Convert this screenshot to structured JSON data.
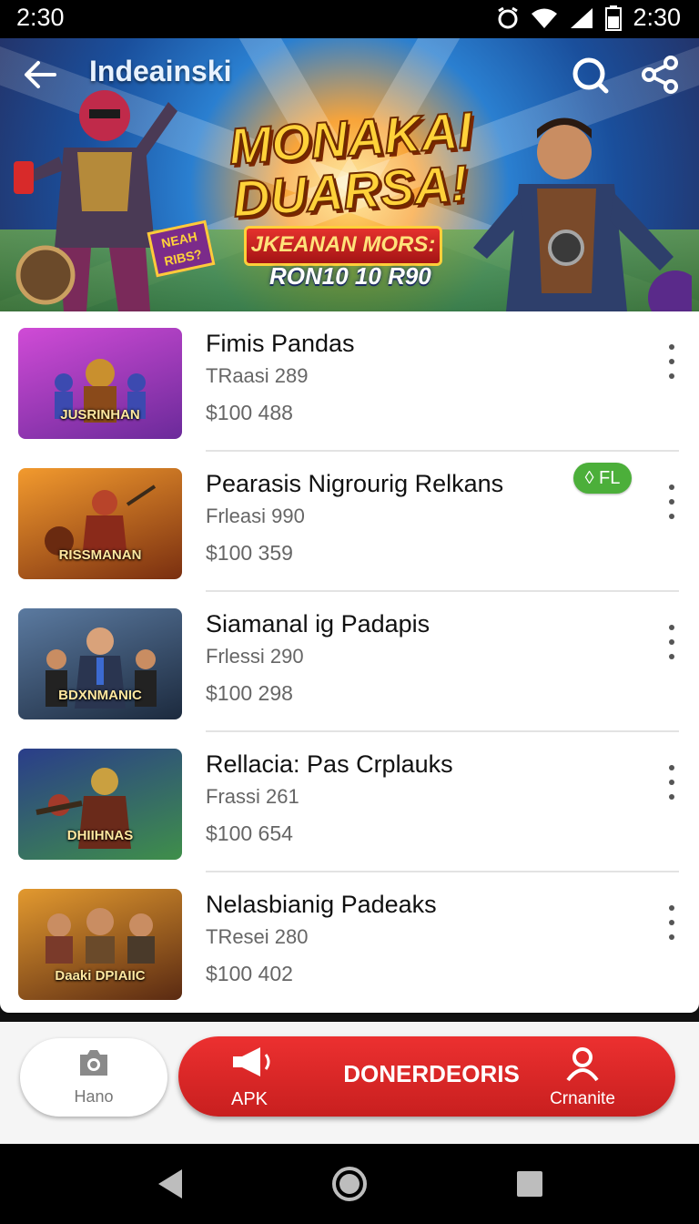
{
  "status_bar": {
    "time_left": "2:30",
    "time_right": "2:30"
  },
  "header": {
    "title": "Indeainski",
    "promo_line1": "MONAKAI",
    "promo_line2": "DUARSA!",
    "promo_ribbon": "JKEANAN MORS:",
    "promo_sub": "RON10 10 R90",
    "sticker": "NEAH RIBS?"
  },
  "games": [
    {
      "title": "Fimis Pandas",
      "sub": "TRaasi 289",
      "price": "$100  488",
      "thumb_label": "JUSRINHAN",
      "thumb_colors": [
        "#d04bd6",
        "#6b2a9a"
      ]
    },
    {
      "title": "Pearasis Nigrourig Relkans",
      "sub": "Frleasi 990",
      "price": "$100  359",
      "thumb_label": "RISSMANAN",
      "thumb_colors": [
        "#f29a2e",
        "#7a2f10"
      ],
      "badge": "FL"
    },
    {
      "title": "Siamanal ig Padapis",
      "sub": "Frlessi 290",
      "price": "$100  298",
      "thumb_label": "BDXNMANIC",
      "thumb_colors": [
        "#5b7aa0",
        "#1c2a3e"
      ]
    },
    {
      "title": "Rellacia: Pas Crplauks",
      "sub": "Frassi 261",
      "price": "$100  654",
      "thumb_label": "DHIIHNAS",
      "thumb_colors": [
        "#3f8f4a",
        "#2a3d8a"
      ]
    },
    {
      "title": "Nelasbianig Padeaks",
      "sub": "TResei 280",
      "price": "$100  402",
      "thumb_label": "Daaki DPIAIIC",
      "thumb_colors": [
        "#e2992f",
        "#5a2a12"
      ]
    }
  ],
  "actions": {
    "home_label": "Hano",
    "apk_label": "APK",
    "main_label": "DONERDEORIS",
    "account_label": "Crnanite"
  }
}
